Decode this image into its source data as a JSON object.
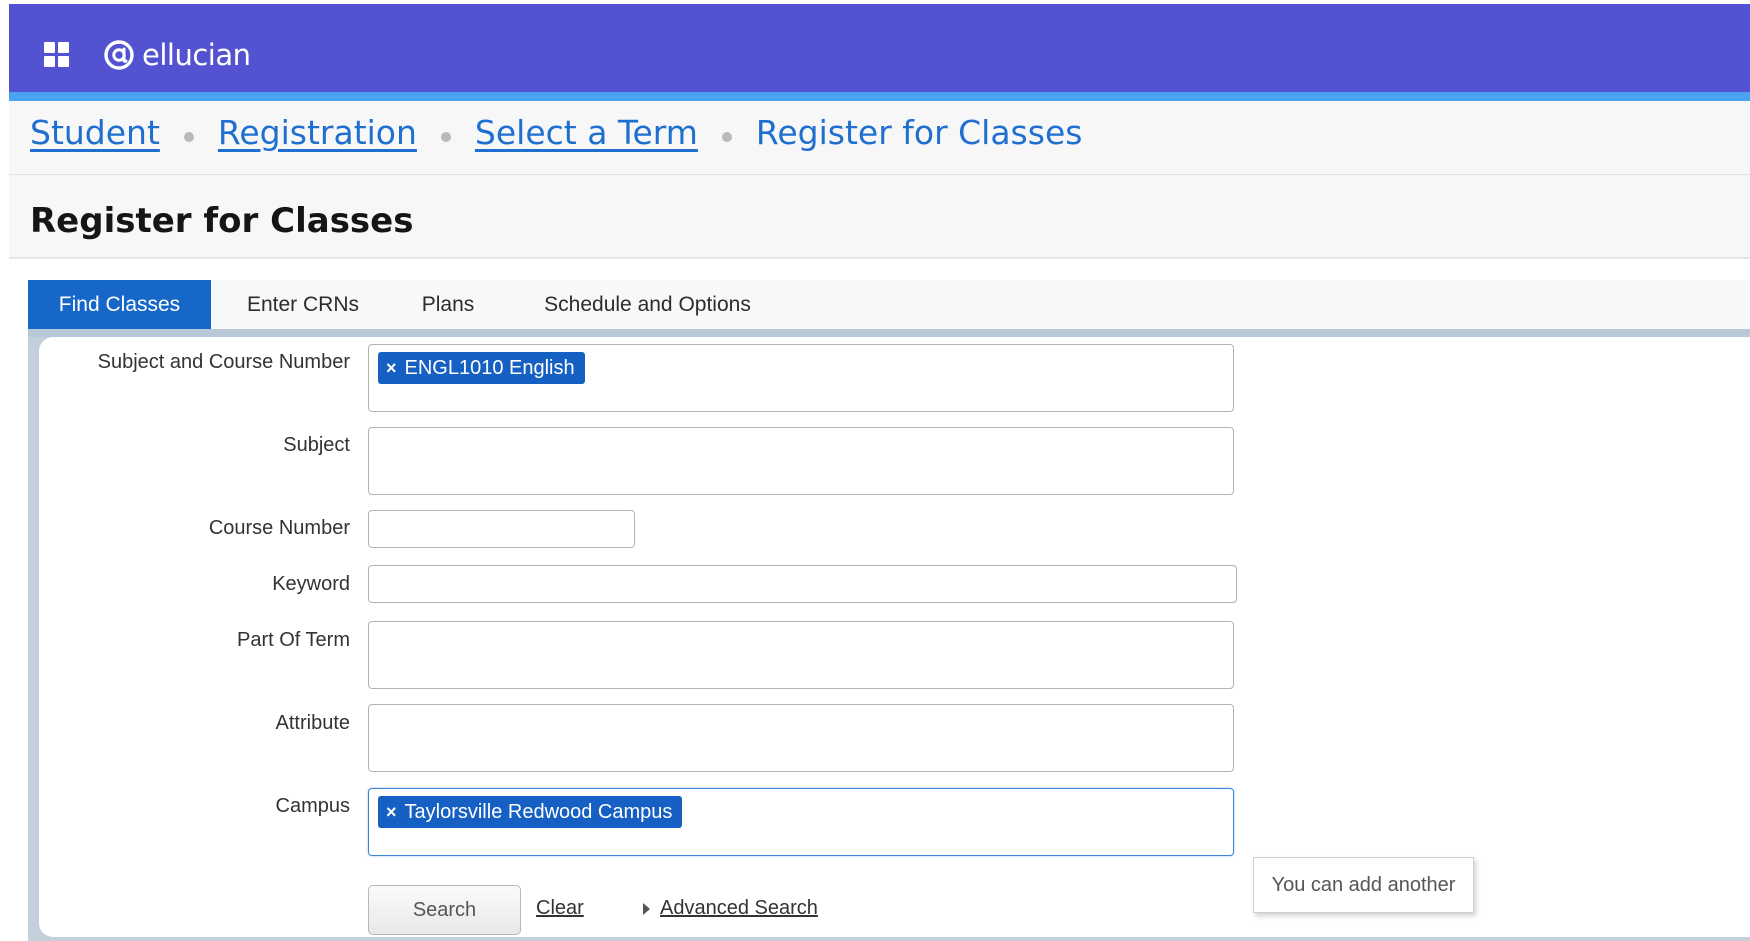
{
  "header": {
    "logo_text": "ellucian",
    "colors": {
      "bar": "#5353d1",
      "accent": "#4aa3f2"
    }
  },
  "breadcrumb": [
    {
      "label": "Student",
      "link": true
    },
    {
      "label": "Registration",
      "link": true
    },
    {
      "label": "Select a Term",
      "link": true
    },
    {
      "label": "Register for Classes",
      "link": false
    }
  ],
  "page": {
    "title": "Register for Classes"
  },
  "tabs": [
    {
      "label": "Find Classes",
      "active": true
    },
    {
      "label": "Enter CRNs",
      "active": false
    },
    {
      "label": "Plans",
      "active": false
    },
    {
      "label": "Schedule and Options",
      "active": false
    }
  ],
  "form": {
    "subject_course": {
      "label": "Subject and Course Number",
      "tags": [
        "ENGL1010 English"
      ]
    },
    "subject": {
      "label": "Subject",
      "tags": []
    },
    "course_number": {
      "label": "Course Number",
      "value": ""
    },
    "keyword": {
      "label": "Keyword",
      "value": ""
    },
    "part_of_term": {
      "label": "Part Of Term",
      "tags": []
    },
    "attribute": {
      "label": "Attribute",
      "tags": []
    },
    "campus": {
      "label": "Campus",
      "tags": [
        "Taylorsville Redwood Campus"
      ]
    }
  },
  "actions": {
    "search_label": "Search",
    "clear_label": "Clear",
    "advanced_label": "Advanced Search"
  },
  "tooltip": {
    "text": "You can add another"
  },
  "icons": {
    "apps": "apps-grid-icon",
    "logo": "ellucian-logo-icon",
    "tag_remove": "close-icon",
    "expand": "caret-right-icon"
  }
}
